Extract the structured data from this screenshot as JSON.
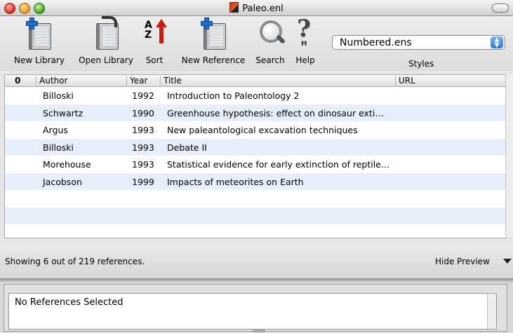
{
  "window": {
    "title": "Paleo.enl"
  },
  "toolbar": {
    "new_library": "New Library",
    "open_library": "Open Library",
    "sort": "Sort",
    "sort_icon_text": "AZ",
    "new_reference": "New Reference",
    "search": "Search",
    "help": "Help",
    "help_icon_text": "?",
    "help_icon_sub": "H",
    "styles_value": "Numbered.ens",
    "styles_label": "Styles"
  },
  "table": {
    "columns": {
      "clip": "0",
      "author": "Author",
      "year": "Year",
      "title": "Title",
      "url": "URL"
    },
    "rows": [
      {
        "author": "Billoski",
        "year": "1992",
        "title": "Introduction to Paleontology 2"
      },
      {
        "author": "Schwartz",
        "year": "1990",
        "title": "Greenhouse hypothesis: effect on dinosaur exti…"
      },
      {
        "author": "Argus",
        "year": "1993",
        "title": "New paleantological excavation techniques"
      },
      {
        "author": "Billoski",
        "year": "1993",
        "title": "Debate II"
      },
      {
        "author": "Morehouse",
        "year": "1993",
        "title": "Statistical evidence for early extinction of reptile…"
      },
      {
        "author": "Jacobson",
        "year": "1999",
        "title": "Impacts of meteorites on Earth"
      },
      {
        "author": "",
        "year": "",
        "title": ""
      },
      {
        "author": "",
        "year": "",
        "title": ""
      },
      {
        "author": "",
        "year": "",
        "title": ""
      }
    ]
  },
  "status": {
    "text": "Showing 6 out of 219 references.",
    "hide_preview": "Hide Preview"
  },
  "preview": {
    "text": "No References Selected"
  },
  "icons": {
    "close": "close-traffic-light",
    "minimize": "minimize-traffic-light",
    "zoom": "zoom-traffic-light",
    "new_library": "new-library-icon",
    "open_library": "open-library-icon",
    "sort": "sort-icon",
    "new_reference": "new-reference-icon",
    "search": "search-icon",
    "help": "help-icon",
    "attachment": "paperclip-icon"
  },
  "colors": {
    "row_alt": "#e7eefb",
    "select_accent": "#2e74d8",
    "close": "#d8261c",
    "minimize": "#e3961a",
    "zoom": "#3d9e1c"
  }
}
